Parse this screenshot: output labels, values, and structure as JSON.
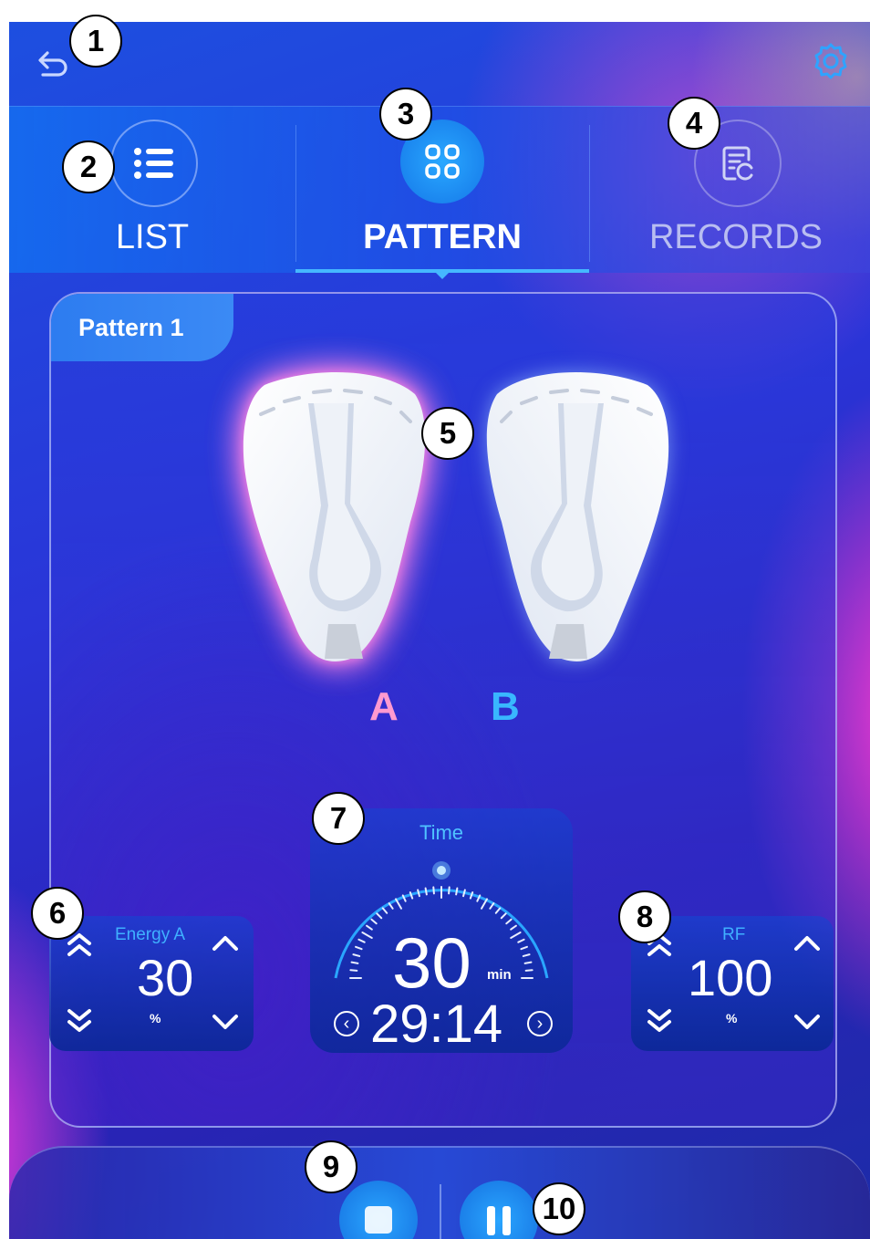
{
  "tabs": [
    {
      "label": "LIST",
      "icon": "list-icon",
      "active": false
    },
    {
      "label": "PATTERN",
      "icon": "grid-icon",
      "active": true
    },
    {
      "label": "RECORDS",
      "icon": "records-icon",
      "active": false
    }
  ],
  "panel": {
    "pattern_name": "Pattern 1",
    "pads": [
      {
        "label": "A",
        "color": "#ff9ad0",
        "glow": "pink"
      },
      {
        "label": "B",
        "color": "#39b7ff",
        "glow": "none"
      }
    ]
  },
  "energy": {
    "label": "Energy A",
    "value": "30",
    "unit": "%"
  },
  "time": {
    "label": "Time",
    "total": "30",
    "unit": "min",
    "remaining": "29:14",
    "prev_glyph": "‹",
    "next_glyph": "›"
  },
  "rf": {
    "label": "RF",
    "value": "100",
    "unit": "%"
  },
  "callouts": [
    "1",
    "2",
    "3",
    "4",
    "5",
    "6",
    "7",
    "8",
    "9",
    "10"
  ],
  "colors": {
    "accent": "#2aa6ff",
    "tab_underline": "#45b8ff",
    "pad_a_glow": "#ff6edc"
  }
}
